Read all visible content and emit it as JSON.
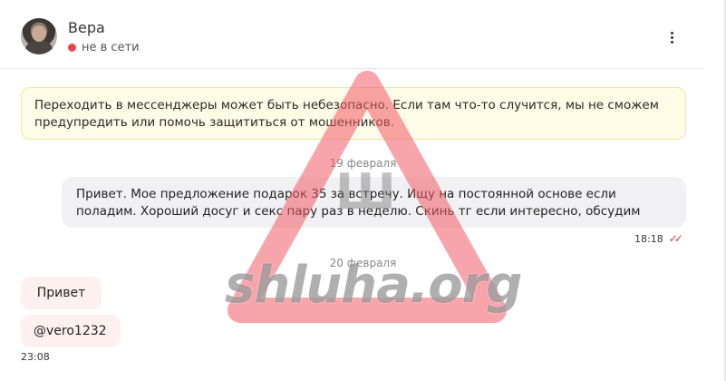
{
  "contact": {
    "name": "Вера",
    "status": "не в сети"
  },
  "warning": {
    "text": "Переходить в мессенджеры может быть небезопасно. Если там что-то случится, мы не сможем предупредить или помочь защититься от мошенников."
  },
  "messages": [
    {
      "date": "19 февраля",
      "direction": "outgoing",
      "text": "Привет. Мое предложение подарок 35 за встречу. Ищу на постоянной основе если поладим. Хороший досуг и секс пару раз в неделю. Скинь тг если интересно, обсудим",
      "time": "18:18",
      "read_icon": "double-check"
    },
    {
      "date": "20 февраля",
      "direction": "incoming",
      "texts": [
        "Привет",
        "@vero1232"
      ],
      "time": "23:08"
    }
  ],
  "watermark": {
    "text": "shluha.org",
    "sign_letter": "Ш"
  },
  "colors": {
    "status_offline": "#e5484d",
    "warning_bg": "#fefbe6",
    "outgoing_bubble": "#f1f1f3",
    "incoming_bubble": "#fdf0ef",
    "read_ticks": "#d8384b",
    "watermark_triangle": "#f0707a"
  },
  "icons": {
    "menu": "more-vertical-icon",
    "status_dot": "offline-dot-icon",
    "read": "double-check-icon"
  }
}
